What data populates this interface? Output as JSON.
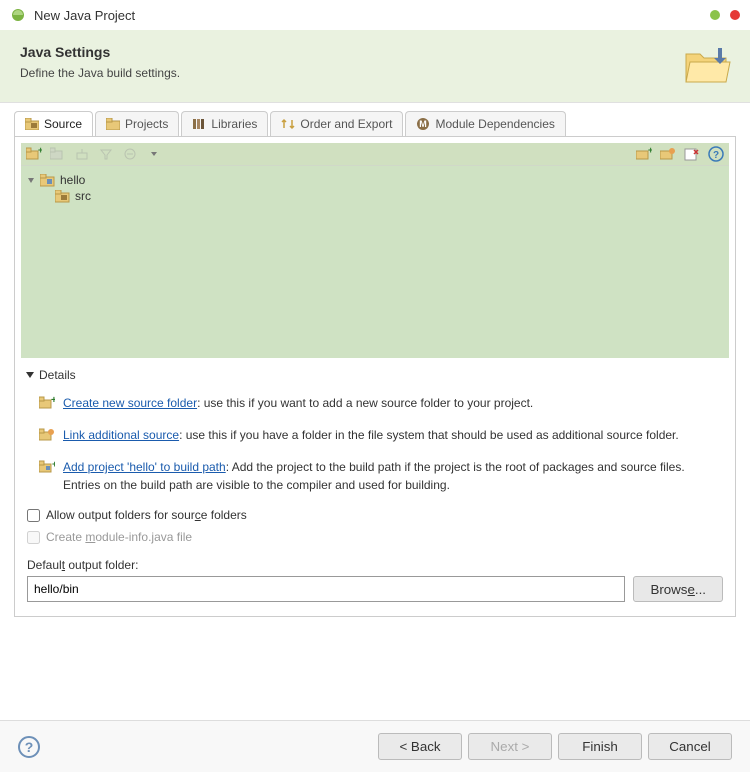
{
  "window": {
    "title": "New Java Project"
  },
  "header": {
    "title": "Java Settings",
    "subtitle": "Define the Java build settings."
  },
  "tabs": {
    "source": "Source",
    "projects": "Projects",
    "libraries": "Libraries",
    "order": "Order and Export",
    "modules": "Module Dependencies"
  },
  "tree": {
    "root": "hello",
    "child": "src"
  },
  "details": {
    "label": "Details",
    "item1_link": "Create new source folder",
    "item1_text": ": use this if you want to add a new source folder to your project.",
    "item2_link": "Link additional source",
    "item2_text": ": use this if you have a folder in the file system that should be used as additional source folder.",
    "item3_link": "Add project 'hello' to build path",
    "item3_text": ": Add the project to the build path if the project is the root of packages and source files. Entries on the build path are visible to the compiler and used for building."
  },
  "checkboxes": {
    "allow_output_pre": "Allow output folders for sour",
    "allow_output_u": "c",
    "allow_output_post": "e folders",
    "create_module_pre": "Create ",
    "create_module_u": "m",
    "create_module_post": "odule-info.java file"
  },
  "output": {
    "label_pre": "Defaul",
    "label_u": "t",
    "label_post": " output folder:",
    "value": "hello/bin",
    "browse_pre": "Brows",
    "browse_u": "e",
    "browse_post": "..."
  },
  "footer": {
    "back": "< Back",
    "next": "Next >",
    "finish": "Finish",
    "cancel": "Cancel"
  }
}
